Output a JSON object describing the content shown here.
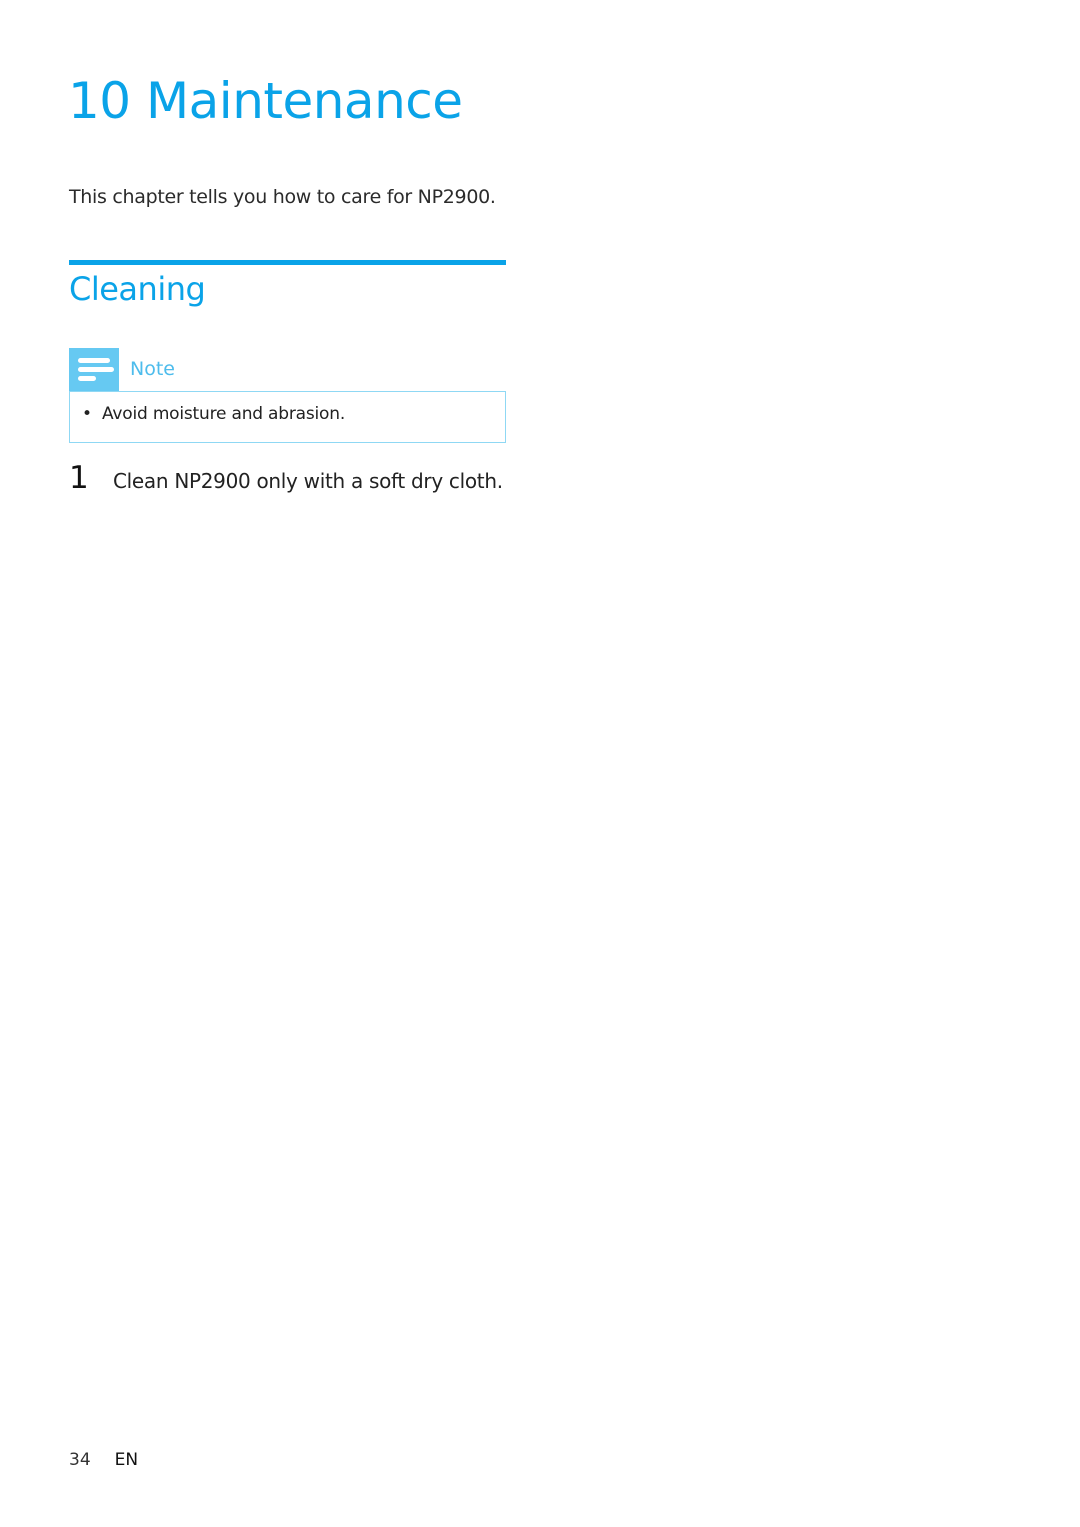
{
  "chapter": {
    "title": "10 Maintenance",
    "intro": "This chapter tells you how to care for NP2900."
  },
  "section": {
    "title": "Cleaning"
  },
  "note": {
    "icon": "note-lines-icon",
    "label": "Note",
    "items": [
      "Avoid moisture and abrasion."
    ]
  },
  "steps": [
    {
      "number": "1",
      "text": "Clean NP2900 only with a soft dry cloth."
    }
  ],
  "footer": {
    "page_number": "34",
    "language": "EN"
  },
  "colors": {
    "accent": "#0aa3e8",
    "note_icon_bg": "#66c9f2",
    "note_border": "#8fd8f4"
  }
}
